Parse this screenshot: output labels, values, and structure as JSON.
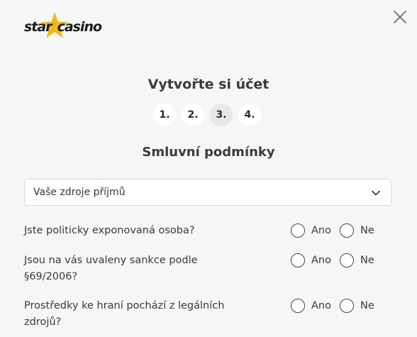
{
  "brand": {
    "part1": "star",
    "part2": "casino"
  },
  "colors": {
    "accent": "#f5b81c",
    "background": "#f6f6f6",
    "text": "#2b2b2b"
  },
  "title": "Vytvořte si účet",
  "steps": [
    {
      "label": "1.",
      "active": false
    },
    {
      "label": "2.",
      "active": false
    },
    {
      "label": "3.",
      "active": true
    },
    {
      "label": "4.",
      "active": false
    }
  ],
  "section_title": "Smluvní podmínky",
  "income_select": {
    "value": "Vaše zdroje příjmů"
  },
  "questions": [
    {
      "text": "Jste politicky exponovaná osoba?",
      "yes": "Ano",
      "no": "Ne"
    },
    {
      "text": "Jsou na vás uvaleny sankce podle §69/2006?",
      "yes": "Ano",
      "no": "Ne"
    },
    {
      "text": "Prostředky ke hraní pochází z legálních zdrojů?",
      "yes": "Ano",
      "no": "Ne"
    }
  ],
  "icons": {
    "close": "close-icon",
    "select_arrow": "chevron-down-icon",
    "logo": "star-icon"
  }
}
